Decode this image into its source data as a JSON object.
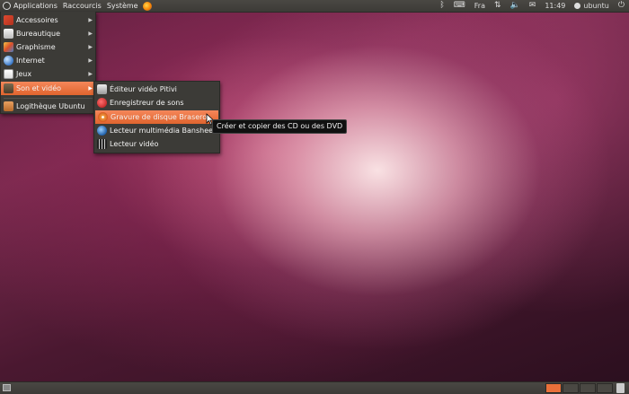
{
  "top_panel": {
    "menus": [
      {
        "label": "Applications"
      },
      {
        "label": "Raccourcis"
      },
      {
        "label": "Système"
      }
    ],
    "tray": {
      "keyboard_layout": "Fra",
      "clock": "11:49",
      "user": "ubuntu"
    }
  },
  "applications_menu": {
    "items": [
      {
        "label": "Accessoires",
        "icon": "accessories-icon",
        "submenu": true
      },
      {
        "label": "Bureautique",
        "icon": "office-icon",
        "submenu": true
      },
      {
        "label": "Graphisme",
        "icon": "graphics-icon",
        "submenu": true
      },
      {
        "label": "Internet",
        "icon": "internet-globe-icon",
        "submenu": true
      },
      {
        "label": "Jeux",
        "icon": "games-icon",
        "submenu": true
      },
      {
        "label": "Son et vidéo",
        "icon": "sound-video-icon",
        "submenu": true,
        "active": true
      },
      {
        "label": "Logithèque Ubuntu",
        "icon": "software-center-icon",
        "submenu": false
      }
    ]
  },
  "sound_video_submenu": {
    "items": [
      {
        "label": "Éditeur vidéo Pitivi",
        "icon": "pitivi-icon"
      },
      {
        "label": "Enregistreur de sons",
        "icon": "sound-recorder-icon"
      },
      {
        "label": "Gravure de disque Brasero",
        "icon": "brasero-icon",
        "active": true
      },
      {
        "label": "Lecteur multimédia Banshee",
        "icon": "banshee-icon"
      },
      {
        "label": "Lecteur vidéo",
        "icon": "video-player-icon"
      }
    ]
  },
  "tooltip": {
    "text": "Créer et copier des CD ou des DVD"
  },
  "colors": {
    "panel": "#3c3b37",
    "highlight": "#e9703a",
    "menu_bg": "#3c3b37"
  }
}
